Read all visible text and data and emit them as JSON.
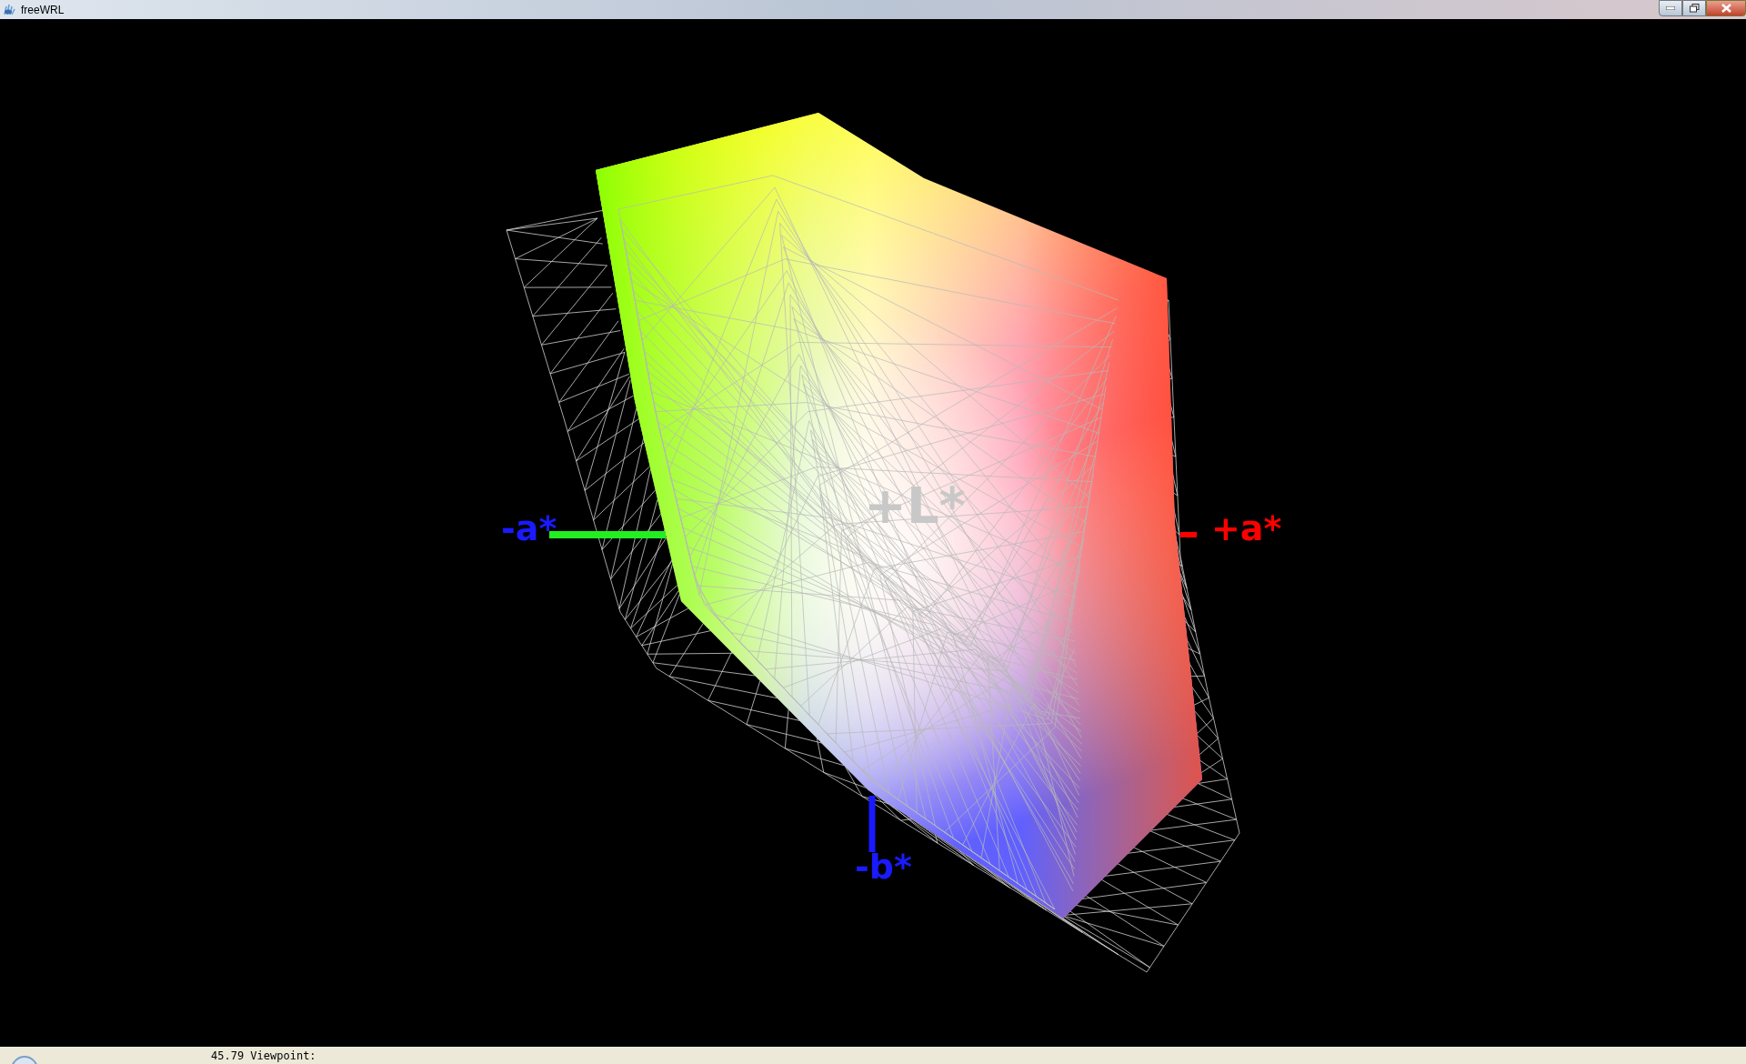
{
  "window": {
    "title": "freeWRL"
  },
  "scene": {
    "axis_labels": [
      {
        "kind": "neg_a",
        "text": "-a*",
        "color": "#1a1aff"
      },
      {
        "kind": "pos_a",
        "text": "+a*",
        "color": "#ff0000"
      },
      {
        "kind": "neg_b",
        "text": "-b*",
        "color": "#1a1aff"
      },
      {
        "kind": "pos_l",
        "text": "+L*",
        "color": "#c8c8c8"
      }
    ]
  },
  "status_bar": {
    "text": "45.79 Viewpoint:"
  }
}
